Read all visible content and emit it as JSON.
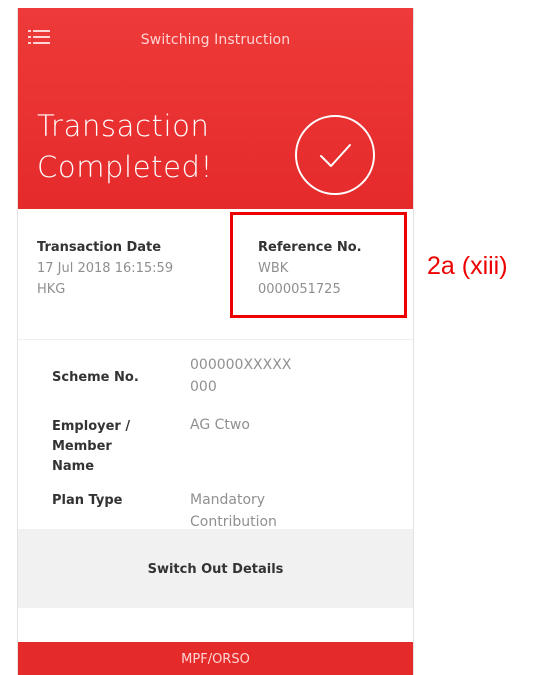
{
  "header": {
    "title": "Switching Instruction",
    "menu_icon": "hamburger-menu-icon",
    "status_line1": "Transaction",
    "status_line2": "Completed!",
    "check_icon": "checkmark-circle-icon"
  },
  "transaction": {
    "date_label": "Transaction Date",
    "date_value_line1": "17 Jul 2018 16:15:59",
    "date_value_line2": "HKG",
    "reference_label": "Reference No.",
    "reference_value_line1": "WBK",
    "reference_value_line2": "0000051725"
  },
  "details": {
    "scheme_label": "Scheme No.",
    "scheme_value_line1": "000000XXXXX",
    "scheme_value_line2": "000",
    "employer_label_line1": "Employer /",
    "employer_label_line2": "Member",
    "employer_label_line3": "Name",
    "employer_value": "AG Ctwo",
    "plan_label": "Plan Type",
    "plan_value_line1": "Mandatory",
    "plan_value_line2": "Contribution"
  },
  "switch_out": {
    "label": "Switch Out Details"
  },
  "footer": {
    "label": "MPF/ORSO"
  },
  "annotation": {
    "label": "2a (xiii)"
  },
  "colors": {
    "brand_red": "#e52a2a",
    "annotation_red": "#ee0000"
  }
}
